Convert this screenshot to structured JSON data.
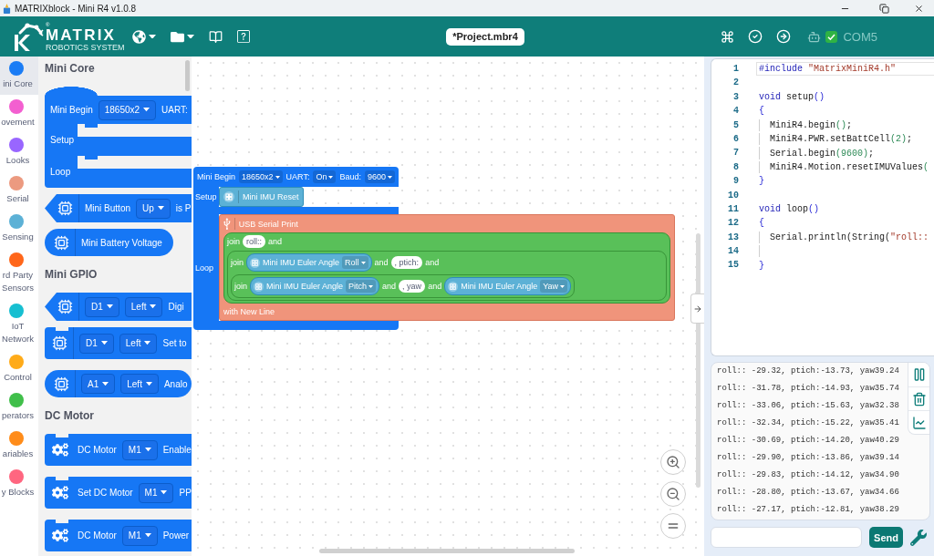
{
  "window": {
    "title": "MATRIXblock - Mini R4 v1.0.8"
  },
  "header": {
    "logo": {
      "registered": "®",
      "name": "MATRIX",
      "tagline": "ROBOTICS SYSTEM"
    },
    "project_name": "*Project.mbr4",
    "port": {
      "checked": true,
      "label": "COM5"
    }
  },
  "categories": [
    {
      "label": "ini Core",
      "color": "#1a7cf5",
      "selected": true
    },
    {
      "label": "ovement",
      "color": "#f35fd0",
      "selected": false
    },
    {
      "label": "Looks",
      "color": "#9966ff",
      "selected": false
    },
    {
      "label": "Serial",
      "color": "#ec9a80",
      "selected": false
    },
    {
      "label": "Sensing",
      "color": "#5cb1d6",
      "selected": false
    },
    {
      "label": "rd Party Sensors",
      "color": "#ff661a",
      "selected": false
    },
    {
      "label": "IoT Network",
      "color": "#17bfd1",
      "selected": false
    },
    {
      "label": "Control",
      "color": "#ffab19",
      "selected": false
    },
    {
      "label": "perators",
      "color": "#40bf4a",
      "selected": false
    },
    {
      "label": "ariables",
      "color": "#ff8c1a",
      "selected": false
    },
    {
      "label": "y Blocks",
      "color": "#ff6680",
      "selected": false
    }
  ],
  "palette": {
    "sections": [
      {
        "title": "Mini Core",
        "blocks": [
          {
            "kind": "hat",
            "parts": [
              {
                "kind": "label",
                "text": "Mini Begin"
              },
              {
                "kind": "dropdown",
                "text": "18650x2"
              },
              {
                "kind": "label",
                "text": "UART:"
              }
            ],
            "slots": [
              "Setup",
              "Loop"
            ]
          },
          {
            "kind": "boolean",
            "parts": [
              {
                "kind": "label",
                "text": "Mini Button"
              },
              {
                "kind": "dropdown",
                "text": "Up"
              },
              {
                "kind": "label",
                "text": "is P"
              }
            ]
          },
          {
            "kind": "reporter",
            "parts": [
              {
                "kind": "label",
                "text": "Mini Battery Voltage"
              }
            ]
          }
        ]
      },
      {
        "title": "Mini GPIO",
        "blocks": [
          {
            "kind": "boolean",
            "parts": [
              {
                "kind": "dropdown",
                "text": "D1"
              },
              {
                "kind": "dropdown",
                "text": "Left"
              },
              {
                "kind": "label",
                "text": "Digi"
              }
            ]
          },
          {
            "kind": "statement",
            "parts": [
              {
                "kind": "dropdown",
                "text": "D1"
              },
              {
                "kind": "dropdown",
                "text": "Left"
              },
              {
                "kind": "label",
                "text": "Set to"
              }
            ]
          },
          {
            "kind": "reporter",
            "parts": [
              {
                "kind": "dropdown",
                "text": "A1"
              },
              {
                "kind": "dropdown",
                "text": "Left"
              },
              {
                "kind": "label",
                "text": "Analo"
              }
            ]
          }
        ]
      },
      {
        "title": "DC Motor",
        "blocks": [
          {
            "kind": "statement",
            "parts": [
              {
                "kind": "label",
                "text": "DC Motor"
              },
              {
                "kind": "dropdown",
                "text": "M1"
              },
              {
                "kind": "label",
                "text": "Enable"
              }
            ]
          },
          {
            "kind": "statement",
            "parts": [
              {
                "kind": "label",
                "text": "Set DC Motor"
              },
              {
                "kind": "dropdown",
                "text": "M1"
              },
              {
                "kind": "label",
                "text": "PP"
              }
            ]
          },
          {
            "kind": "statement",
            "parts": [
              {
                "kind": "label",
                "text": "DC Motor"
              },
              {
                "kind": "dropdown",
                "text": "M1"
              },
              {
                "kind": "label",
                "text": "Power"
              }
            ]
          }
        ]
      }
    ]
  },
  "workspace": {
    "script": {
      "parts": [
        {
          "kind": "label",
          "text": "Mini Begin"
        },
        {
          "kind": "dropdown",
          "text": "18650x2"
        },
        {
          "kind": "label",
          "text": "UART:"
        },
        {
          "kind": "dropdown",
          "text": "On"
        },
        {
          "kind": "label",
          "text": "Baud:"
        },
        {
          "kind": "dropdown",
          "text": "9600"
        }
      ],
      "slots": [
        {
          "label": "Setup",
          "blocks": [
            {
              "kind": "sensor",
              "parts": [
                {
                  "kind": "label",
                  "text": "Mini IMU Reset"
                }
              ]
            }
          ]
        },
        {
          "label": "Loop",
          "blocks": [
            {
              "kind": "serial",
              "parts": [
                {
                  "kind": "label",
                  "text": "USB Serial Print"
                },
                {
                  "kind": "operator",
                  "parts": [
                    {
                      "kind": "label",
                      "text": "join"
                    },
                    {
                      "kind": "string",
                      "text": "roll::"
                    },
                    {
                      "kind": "label",
                      "text": "and"
                    },
                    {
                      "kind": "operator",
                      "parts": [
                        {
                          "kind": "label",
                          "text": "join"
                        },
                        {
                          "kind": "sensor",
                          "parts": [
                            {
                              "kind": "label",
                              "text": "Mini IMU Euler Angle"
                            },
                            {
                              "kind": "dropdown",
                              "text": "Roll"
                            }
                          ]
                        },
                        {
                          "kind": "label",
                          "text": "and"
                        },
                        {
                          "kind": "string",
                          "text": ", ptich:"
                        },
                        {
                          "kind": "label",
                          "text": "and"
                        },
                        {
                          "kind": "operator",
                          "parts": [
                            {
                              "kind": "label",
                              "text": "join"
                            },
                            {
                              "kind": "sensor",
                              "parts": [
                                {
                                  "kind": "label",
                                  "text": "Mini IMU Euler Angle"
                                },
                                {
                                  "kind": "dropdown",
                                  "text": "Pitch"
                                }
                              ]
                            },
                            {
                              "kind": "label",
                              "text": "and"
                            },
                            {
                              "kind": "string",
                              "text": ", yaw"
                            },
                            {
                              "kind": "label",
                              "text": "and"
                            },
                            {
                              "kind": "sensor",
                              "parts": [
                                {
                                  "kind": "label",
                                  "text": "Mini IMU Euler Angle"
                                },
                                {
                                  "kind": "dropdown",
                                  "text": "Yaw"
                                }
                              ]
                            }
                          ]
                        }
                      ]
                    }
                  ]
                },
                {
                  "kind": "label",
                  "text": "with New Line"
                }
              ]
            }
          ]
        }
      ]
    }
  },
  "code_editor": {
    "lines": [
      {
        "number": "1",
        "active": true,
        "indented": false,
        "tokens": [
          {
            "kind": "keyword",
            "text": "#include "
          },
          {
            "kind": "string",
            "text": "\"MatrixMiniR4.h\""
          }
        ]
      },
      {
        "number": "2",
        "active": false,
        "indented": false
      },
      {
        "number": "3",
        "active": false,
        "indented": false,
        "tokens": [
          {
            "kind": "keyword",
            "text": "void "
          },
          {
            "kind": "plain",
            "text": "setup"
          },
          {
            "kind": "bracket",
            "text": "()"
          }
        ]
      },
      {
        "number": "4",
        "active": false,
        "indented": false,
        "tokens": [
          {
            "kind": "bracket",
            "text": "{"
          }
        ]
      },
      {
        "number": "5",
        "active": false,
        "indented": true,
        "tokens": [
          {
            "kind": "plain",
            "text": "MiniR4.begin"
          },
          {
            "kind": "call",
            "text": "()"
          },
          {
            "kind": "plain",
            "text": ";"
          }
        ]
      },
      {
        "number": "6",
        "active": false,
        "indented": true,
        "tokens": [
          {
            "kind": "plain",
            "text": "MiniR4.PWR.setBattCell"
          },
          {
            "kind": "call",
            "text": "(2)"
          },
          {
            "kind": "plain",
            "text": ";"
          }
        ]
      },
      {
        "number": "7",
        "active": false,
        "indented": true,
        "tokens": [
          {
            "kind": "plain",
            "text": "Serial.begin"
          },
          {
            "kind": "call",
            "text": "(9600)"
          },
          {
            "kind": "plain",
            "text": ";"
          }
        ]
      },
      {
        "number": "8",
        "active": false,
        "indented": true,
        "tokens": [
          {
            "kind": "plain",
            "text": "MiniR4.Motion.resetIMUValues"
          },
          {
            "kind": "call",
            "text": "("
          }
        ]
      },
      {
        "number": "9",
        "active": false,
        "indented": false,
        "tokens": [
          {
            "kind": "bracket",
            "text": "}"
          }
        ]
      },
      {
        "number": "10",
        "active": false,
        "indented": false
      },
      {
        "number": "11",
        "active": false,
        "indented": false,
        "tokens": [
          {
            "kind": "keyword",
            "text": "void "
          },
          {
            "kind": "plain",
            "text": "loop"
          },
          {
            "kind": "bracket",
            "text": "()"
          }
        ]
      },
      {
        "number": "12",
        "active": false,
        "indented": false,
        "tokens": [
          {
            "kind": "bracket",
            "text": "{"
          }
        ]
      },
      {
        "number": "13",
        "active": false,
        "indented": true,
        "tokens": [
          {
            "kind": "plain",
            "text": "Serial.println(String("
          },
          {
            "kind": "string",
            "text": "\"roll::"
          }
        ]
      },
      {
        "number": "14",
        "active": false,
        "indented": true
      },
      {
        "number": "15",
        "active": false,
        "indented": false,
        "tokens": [
          {
            "kind": "bracket",
            "text": "}"
          }
        ]
      }
    ]
  },
  "serial_monitor": {
    "lines": [
      "roll:: -29.32, ptich:-13.73, yaw39.24",
      "roll:: -31.78, ptich:-14.93, yaw35.74",
      "roll:: -33.06, ptich:-15.63, yaw32.38",
      "roll:: -32.34, ptich:-15.22, yaw35.41",
      "roll:: -30.69, ptich:-14.20, yaw40.29",
      "roll:: -29.90, ptich:-13.86, yaw39.14",
      "roll:: -29.83, ptich:-14.12, yaw34.90",
      "roll:: -28.80, ptich:-13.67, yaw34.66",
      "roll:: -27.17, ptich:-12.81, yaw38.29"
    ],
    "send_button": "Send"
  }
}
